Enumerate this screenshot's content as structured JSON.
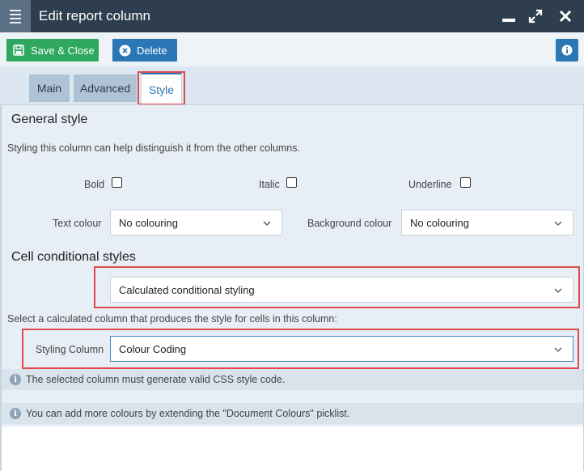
{
  "window": {
    "title": "Edit report column"
  },
  "toolbar": {
    "save_close": "Save & Close",
    "delete": "Delete"
  },
  "tabs": [
    {
      "label": "Main",
      "active": false
    },
    {
      "label": "Advanced",
      "active": false
    },
    {
      "label": "Style",
      "active": true
    }
  ],
  "general": {
    "title": "General style",
    "description": "Styling this column can help distinguish it from the other columns.",
    "bold_label": "Bold",
    "italic_label": "Italic",
    "underline_label": "Underline",
    "text_colour_label": "Text colour",
    "text_colour_value": "No colouring",
    "bg_colour_label": "Background colour",
    "bg_colour_value": "No colouring"
  },
  "conditional": {
    "title": "Cell conditional styles",
    "mode_value": "Calculated conditional styling",
    "description": "Select a calculated column that produces the style for cells in this column:",
    "styling_column_label": "Styling Column",
    "styling_column_value": "Colour Coding",
    "info_1": "The selected column must generate valid CSS style code.",
    "info_2": "You can add more colours by extending the \"Document Colours\" picklist."
  },
  "colors": {
    "titlebar": "#2f3e4e",
    "save": "#2fa75e",
    "primary": "#2b77b5",
    "highlight": "#e04b4b"
  },
  "icons": [
    "hamburger-icon",
    "minimize-icon",
    "maximize-icon",
    "close-icon",
    "save-icon",
    "delete-icon",
    "info-icon",
    "chevron-down-icon"
  ]
}
